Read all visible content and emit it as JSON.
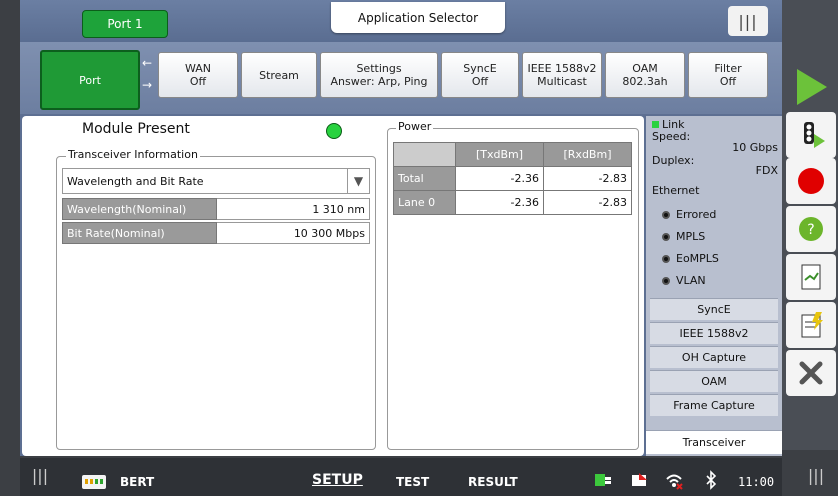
{
  "header": {
    "port_label": "Port 1",
    "app_selector": "Application Selector",
    "grip": "|||"
  },
  "tabs": [
    {
      "l1": "Port",
      "l2": ""
    },
    {
      "l1": "WAN",
      "l2": "Off"
    },
    {
      "l1": "Stream",
      "l2": ""
    },
    {
      "l1": "Settings",
      "l2": "Answer: Arp, Ping"
    },
    {
      "l1": "SyncE",
      "l2": "Off"
    },
    {
      "l1": "IEEE 1588v2",
      "l2": "Multicast"
    },
    {
      "l1": "OAM",
      "l2": "802.3ah"
    },
    {
      "l1": "Filter",
      "l2": "Off"
    }
  ],
  "tab_arrows": {
    "left": "←",
    "right": "→"
  },
  "module": {
    "status": "Module Present",
    "led_color": "#28d23f"
  },
  "transceiver": {
    "legend": "Transceiver Information",
    "dropdown_value": "Wavelength and Bit Rate",
    "rows": [
      {
        "key": "Wavelength(Nominal)",
        "value": "1 310 nm"
      },
      {
        "key": "Bit Rate(Nominal)",
        "value": "10 300 Mbps"
      }
    ]
  },
  "power": {
    "legend": "Power",
    "headers": [
      "[TxdBm]",
      "[RxdBm]"
    ],
    "rows": [
      {
        "label": "Total",
        "tx": "-2.36",
        "rx": "-2.83"
      },
      {
        "label": "Lane 0",
        "tx": "-2.36",
        "rx": "-2.83"
      }
    ]
  },
  "link": {
    "label": "Link",
    "speed_label": "Speed:",
    "speed_value": "10 Gbps",
    "duplex_label": "Duplex:",
    "duplex_value": "FDX",
    "ethernet_label": "Ethernet",
    "options": [
      "Errored",
      "MPLS",
      "EoMPLS",
      "VLAN"
    ]
  },
  "side_tabs": [
    "SyncE",
    "IEEE 1588v2",
    "OH Capture",
    "OAM",
    "Frame Capture",
    "Transceiver"
  ],
  "bottom": {
    "bert": "BERT",
    "setup": "SETUP",
    "test": "TEST",
    "result": "RESULT",
    "time": "11:00"
  },
  "colors": {
    "active_green": "#1f9a36",
    "record_red": "#e00000",
    "help_green": "#6cb52b"
  }
}
